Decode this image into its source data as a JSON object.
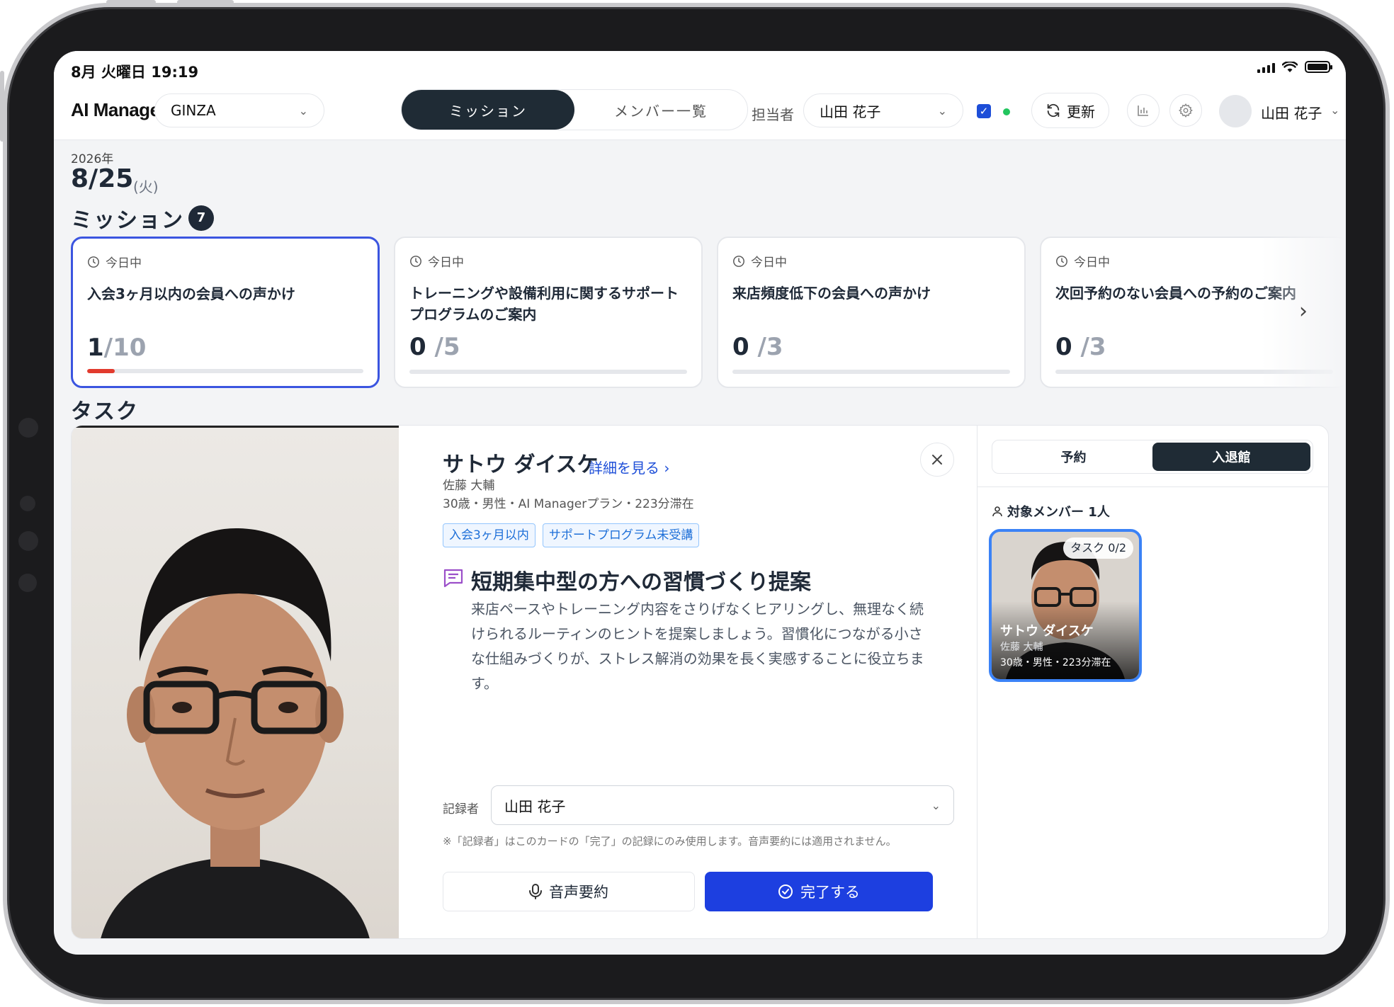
{
  "status_bar": {
    "time": "8月 火曜日 19:19"
  },
  "header": {
    "logo": "AI Manager",
    "store_select": "GINZA",
    "tabs": [
      {
        "label": "ミッション",
        "active": true
      },
      {
        "label": "メンバー一覧",
        "active": false
      }
    ],
    "assignee_label": "担当者",
    "assignee_value": "山田 花子",
    "refresh_label": "更新",
    "user_name": "山田 花子"
  },
  "date": {
    "year": "2026年",
    "day": "8/25",
    "weekday": "(火)"
  },
  "missions": {
    "title": "ミッション",
    "count": "7",
    "cards": [
      {
        "due": "今日中",
        "title": "入会3ヶ月以内の会員への声かけ",
        "done": "1",
        "total": "/10",
        "progress": 0.1,
        "selected": true
      },
      {
        "due": "今日中",
        "title": "トレーニングや設備利用に関するサポートプログラムのご案内",
        "done": "0",
        "total": "/5",
        "progress": 0,
        "selected": false
      },
      {
        "due": "今日中",
        "title": "来店頻度低下の会員への声かけ",
        "done": "0",
        "total": "/3",
        "progress": 0,
        "selected": false
      },
      {
        "due": "今日中",
        "title": "次回予約のない会員への予約のご案内",
        "done": "0",
        "total": "/3",
        "progress": 0,
        "selected": false
      }
    ]
  },
  "tasks": {
    "title": "タスク",
    "member": {
      "name": "サトウ ダイスケ",
      "detail_link": "詳細を見る",
      "kana": "佐藤 大輔",
      "meta": "30歳・男性・AI Managerプラン・223分滞在",
      "tags": [
        "入会3ヶ月以内",
        "サポートプログラム未受講"
      ]
    },
    "highlight": {
      "title": "短期集中型の方への習慣づくり提案",
      "body": "来店ペースやトレーニング内容をさりげなくヒアリングし、無理なく続けられるルーティンのヒントを提案しましょう。習慣化につながる小さな仕組みづくりが、ストレス解消の効果を長く実感することに役立ちます。"
    },
    "recorder_label": "記録者",
    "recorder_value": "山田 花子",
    "note": "※「記録者」はこのカードの「完了」の記録にのみ使用します。音声要約には適用されません。",
    "voice_button": "音声要約",
    "done_button": "完了する"
  },
  "side": {
    "tabs": [
      {
        "label": "予約",
        "active": false
      },
      {
        "label": "入退館",
        "active": true
      }
    ],
    "target_label": "対象メンバー 1人",
    "card": {
      "badge": "タスク 0/2",
      "name": "サトウ ダイスケ",
      "kana": "佐藤 大輔",
      "meta": "30歳・男性・223分滞在"
    }
  },
  "colors": {
    "accent": "#1d3fe0",
    "dark": "#1f2b35",
    "progress": "#e23b2e",
    "selected_border": "#3b55e0"
  }
}
